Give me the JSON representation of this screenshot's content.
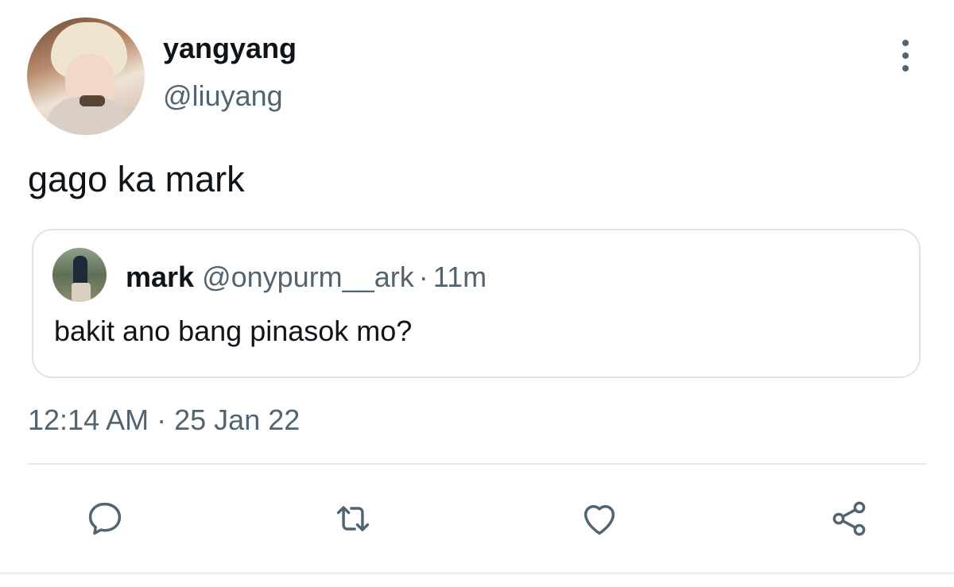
{
  "tweet": {
    "display_name": "yangyang",
    "handle": "@liuyang",
    "text": "gago ka mark",
    "timestamp": "12:14 AM",
    "separator": "·",
    "date": "25 Jan 22"
  },
  "quoted_tweet": {
    "display_name": "mark",
    "handle": "@onypurm__ark",
    "separator": "·",
    "time_ago": "11m",
    "text": "bakit ano bang pinasok mo?"
  },
  "actions": {
    "reply_icon": "reply-icon",
    "retweet_icon": "retweet-icon",
    "like_icon": "heart-icon",
    "share_icon": "share-icon"
  },
  "colors": {
    "primary_text": "#0f1419",
    "secondary_text": "#536471",
    "border": "#dfe3e6",
    "background": "#ffffff"
  }
}
